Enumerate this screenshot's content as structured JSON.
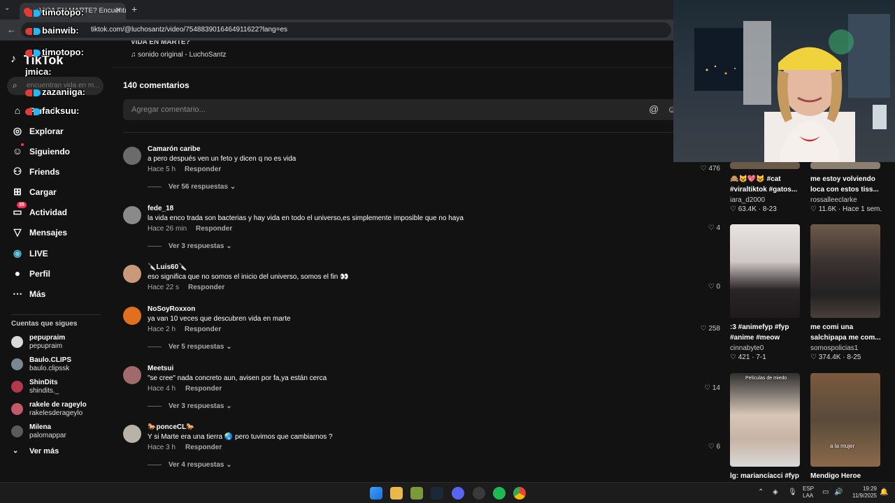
{
  "browser": {
    "tab_title": "¿VIDA EN MARTE? Encuentran ...",
    "url": "tiktok.com/@luchosantz/video/7548839016464911622?lang=es"
  },
  "overlays": [
    "timotopo:",
    "bainwib:",
    "timotopo:",
    "jmica:",
    "zazaniiga:",
    "facksuu:"
  ],
  "sidebar": {
    "logo": "TikTok",
    "search_placeholder": "encuentran vida en m...",
    "nav": [
      {
        "label": "Para ti",
        "icon": "home-icon"
      },
      {
        "label": "Explorar",
        "icon": "compass-icon"
      },
      {
        "label": "Siguiendo",
        "icon": "following-icon"
      },
      {
        "label": "Friends",
        "icon": "friends-icon"
      },
      {
        "label": "Cargar",
        "icon": "upload-icon"
      },
      {
        "label": "Actividad",
        "icon": "inbox-icon",
        "badge": "35"
      },
      {
        "label": "Mensajes",
        "icon": "message-icon"
      },
      {
        "label": "LIVE",
        "icon": "live-icon"
      },
      {
        "label": "Perfil",
        "icon": "profile-icon"
      },
      {
        "label": "Más",
        "icon": "more-icon"
      }
    ],
    "following_title": "Cuentas que sigues",
    "accounts": [
      {
        "name": "pepupraim",
        "handle": "pepupraim",
        "color": "#d9d9d9"
      },
      {
        "name": "Baulo.CLIPS",
        "handle": "baulo.clipssk",
        "color": "#7c8794"
      },
      {
        "name": "ShinDits",
        "handle": "shindits._",
        "color": "#b23a48"
      },
      {
        "name": "rakele de rageylo",
        "handle": "rakelesderageylo",
        "color": "#c25a6a"
      },
      {
        "name": "Milena",
        "handle": "palomappar",
        "color": "#5b5b5b"
      }
    ],
    "see_more": "Ver más"
  },
  "video": {
    "title": "VIDA EN MARTE?",
    "sound": "sonido original - LuchoSantz"
  },
  "comments_section": {
    "count_label": "140 comentarios",
    "input_placeholder": "Agregar comentario..."
  },
  "comments": [
    {
      "user": "Camarón caribe",
      "text": "a pero después ven un feto y dicen q no es vida",
      "time": "Hace 5 h",
      "reply": "Responder",
      "likes": "476",
      "more": "Ver 56 respuestas",
      "color": "#6b6b6b"
    },
    {
      "user": "fede_18",
      "text": "la vida enco trada son bacterias y hay vida en todo el universo,es simplemente imposible que no haya",
      "time": "Hace 26 min",
      "reply": "Responder",
      "likes": "4",
      "more": "Ver 3 respuestas",
      "color": "#8a8a8a"
    },
    {
      "user": "🔪Luis60🔪",
      "text": "eso significa que no somos el inicio del universo, somos el fin 👀",
      "time": "Hace 22 s",
      "reply": "Responder",
      "likes": "0",
      "more": "",
      "color": "#c99a7a"
    },
    {
      "user": "NoSoyRoxxon",
      "text": "ya van 10 veces que descubren vida en marte",
      "time": "Hace 2 h",
      "reply": "Responder",
      "likes": "258",
      "more": "Ver 5 respuestas",
      "color": "#e0701e"
    },
    {
      "user": "Meetsui",
      "text": "\"se cree\" nada concreto aun, avisen por fa,ya están cerca",
      "time": "Hace 4 h",
      "reply": "Responder",
      "likes": "14",
      "more": "Ver 3 respuestas",
      "color": "#a06a6a"
    },
    {
      "user": "🐎ponceCL🐎",
      "text": "Y si Marte era una tierra 🌏 pero tuvimos que cambiarnos ?",
      "time": "Hace 3 h",
      "reply": "Responder",
      "likes": "6",
      "more": "Ver 4 respuestas",
      "color": "#b9b2a8"
    }
  ],
  "related": [
    {
      "caption": "🙈😺💖😺 #cat #viraltiktok #gatos...",
      "author": "iara_d2000",
      "likes": "63.4K",
      "date": "8-23"
    },
    {
      "caption": "me estoy volviendo loca con estos tiss...",
      "author": "rossalleeclarke",
      "likes": "11.6K",
      "date": "Hace 1 sem."
    },
    {
      "caption": ":3 #animefyp #fyp #anime #meow",
      "author": "cinnabyte0",
      "likes": "421",
      "date": "7-1"
    },
    {
      "caption": "me comi una salchipapa me com...",
      "author": "somospolicias1",
      "likes": "374.4K",
      "date": "8-25"
    },
    {
      "caption": "lg: mariancíacci #fyp",
      "thumb_label": "Películas de miedo",
      "author": "",
      "likes": "",
      "date": ""
    },
    {
      "caption": "Mendigo Heroe",
      "thumb_label": "a la mujer",
      "author": "",
      "likes": "",
      "date": ""
    }
  ],
  "taskbar": {
    "lang1": "ESP",
    "lang2": "LAA",
    "time": "19:29",
    "date": "11/9/2025"
  },
  "colors": {
    "accent": "#fe2c55",
    "background": "#121212"
  }
}
